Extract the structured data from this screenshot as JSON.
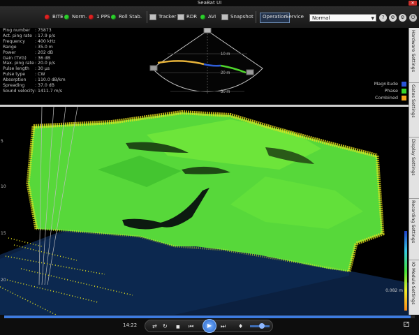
{
  "window": {
    "title": "SeaBat UI",
    "close_label": "✕"
  },
  "toolbar": {
    "status_items": [
      {
        "label": "BITE",
        "color": "#e02020"
      },
      {
        "label": "Norm.",
        "color": "#2bd12b"
      },
      {
        "label": "1 PPS",
        "color": "#e02020"
      },
      {
        "label": "Roll Stab.",
        "color": "#2bd12b"
      }
    ],
    "tool_items": [
      {
        "label": "Tracker",
        "icon": "tracker-icon"
      },
      {
        "label": "RDR",
        "icon": "rdr-icon"
      },
      {
        "label": "AVI",
        "icon": "avi-icon",
        "status_color": "#2bd12b"
      },
      {
        "label": "Snapshot",
        "icon": "snapshot-icon"
      }
    ],
    "modes": [
      "Operation",
      "Service"
    ],
    "active_mode": "Operation",
    "profile_select": "Normal",
    "help_icon": "?",
    "settings_icon": "⚙"
  },
  "sonar_info": [
    {
      "label": "Ping number",
      "value": ": 75873"
    },
    {
      "label": "Act. ping rate",
      "value": ": 17.9 p/s"
    },
    {
      "label": "Frequency",
      "value": ": 400 kHz"
    },
    {
      "label": "Range",
      "value": ": 35.0 m"
    },
    {
      "label": "Power",
      "value": ": 202 dB"
    },
    {
      "label": "Gain (TVG)",
      "value": ": 36 dB"
    },
    {
      "label": "Max. ping rate",
      "value": ": 20.0 p/s"
    },
    {
      "label": "Pulse length",
      "value": ": 30 µs"
    },
    {
      "label": "Pulse type",
      "value": ": CW"
    },
    {
      "label": "Absorption",
      "value": ": 110.0 dB/km"
    },
    {
      "label": "Spreading",
      "value": ": 37.0 dB"
    },
    {
      "label": "Sound velocity",
      "value": ": 1411.7 m/s"
    }
  ],
  "fan": {
    "range_labels": [
      "10 m",
      "20 m",
      "30 m"
    ]
  },
  "legend": [
    {
      "label": "Magnitude",
      "color": "#2a55d8"
    },
    {
      "label": "Phase",
      "color": "#36d62c"
    },
    {
      "label": "Combined",
      "color": "#f2a31b"
    }
  ],
  "view3d": {
    "depth_ticks": [
      "5",
      "10",
      "15",
      "20"
    ],
    "scale_label": "0.082 m",
    "colors": {
      "surface": "#5ee33a",
      "edge": "#e6e21e",
      "floor": "#0b2040"
    }
  },
  "sidebar_tabs": [
    "Hardware Settings",
    "Gates Settings",
    "Display Settings",
    "Recording Settings",
    "IO Module Settings"
  ],
  "player": {
    "time": "14:22",
    "progress": 0.99,
    "controls": {
      "shuffle": "⇄",
      "repeat": "↻",
      "stop": "■",
      "prev": "⏮",
      "play": "▶",
      "next": "⏭",
      "volume": "♦"
    },
    "volume": 0.6,
    "fullscreen": "⤢"
  }
}
